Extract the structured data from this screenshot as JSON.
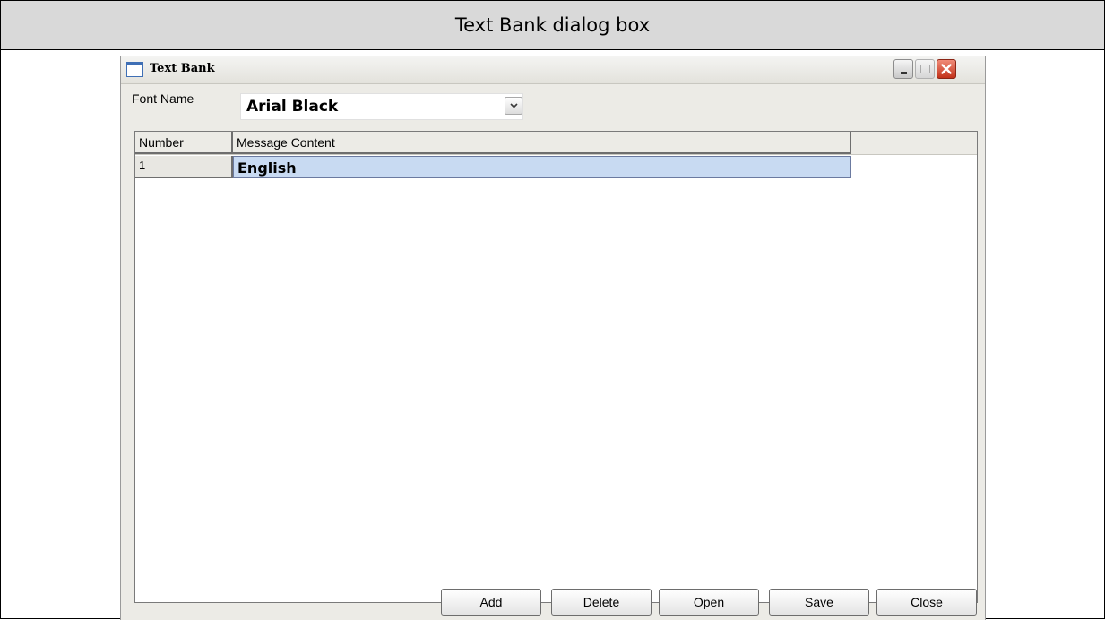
{
  "caption": "Text Bank dialog box",
  "window": {
    "title": "Text Bank"
  },
  "font": {
    "label": "Font Name",
    "value": "Arial Black"
  },
  "grid": {
    "columns": [
      "Number",
      "Message Content"
    ],
    "rows": [
      {
        "number": "1",
        "content": "English"
      }
    ]
  },
  "buttons": {
    "add": "Add",
    "delete": "Delete",
    "open": "Open",
    "save": "Save",
    "close": "Close"
  }
}
